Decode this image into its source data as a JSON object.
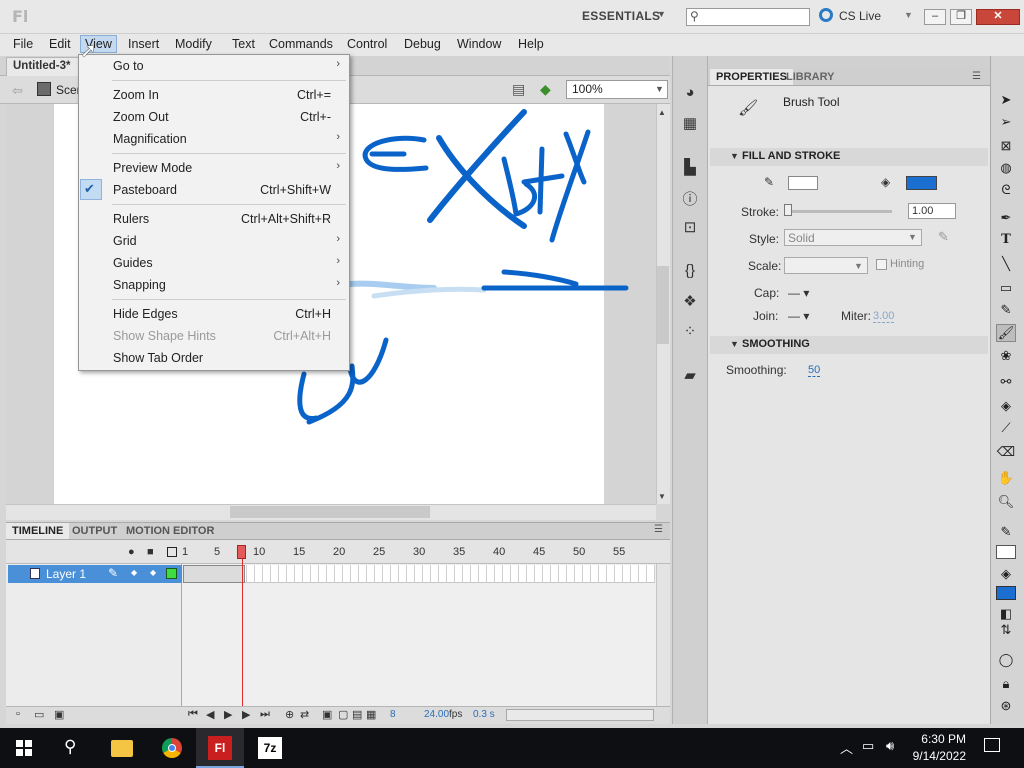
{
  "app": {
    "logo": "Fl",
    "workspace": "ESSENTIALS",
    "cs_live": "CS Live"
  },
  "menubar": [
    "File",
    "Edit",
    "View",
    "Insert",
    "Modify",
    "Text",
    "Commands",
    "Control",
    "Debug",
    "Window",
    "Help"
  ],
  "document": {
    "tab": "Untitled-3*",
    "scene": "Scene 1",
    "zoom": "100%"
  },
  "view_menu": [
    {
      "label": "Go to",
      "shortcut": "",
      "submenu": true
    },
    {
      "label": "Zoom In",
      "shortcut": "Ctrl+="
    },
    {
      "label": "Zoom Out",
      "shortcut": "Ctrl+-"
    },
    {
      "label": "Magnification",
      "shortcut": "",
      "submenu": true
    },
    {
      "label": "Preview Mode",
      "shortcut": "",
      "submenu": true
    },
    {
      "label": "Pasteboard",
      "shortcut": "Ctrl+Shift+W",
      "checked": true
    },
    {
      "label": "Rulers",
      "shortcut": "Ctrl+Alt+Shift+R"
    },
    {
      "label": "Grid",
      "shortcut": "",
      "submenu": true
    },
    {
      "label": "Guides",
      "shortcut": "",
      "submenu": true
    },
    {
      "label": "Snapping",
      "shortcut": "",
      "submenu": true
    },
    {
      "label": "Hide Edges",
      "shortcut": "Ctrl+H"
    },
    {
      "label": "Show Shape Hints",
      "shortcut": "Ctrl+Alt+H",
      "disabled": true
    },
    {
      "label": "Show Tab Order",
      "shortcut": ""
    }
  ],
  "timeline": {
    "tabs": [
      "TIMELINE",
      "OUTPUT",
      "MOTION EDITOR"
    ],
    "frame_numbers": [
      "1",
      "5",
      "10",
      "15",
      "20",
      "25",
      "30",
      "35",
      "40",
      "45",
      "50",
      "55"
    ],
    "layer_name": "Layer 1",
    "current_frame": "8",
    "fps": "24.00",
    "fps_unit": "fps",
    "elapsed": "0.3 s"
  },
  "properties": {
    "tabs": [
      "PROPERTIES",
      "LIBRARY"
    ],
    "tool": "Brush Tool",
    "fill_stroke_head": "FILL AND STROKE",
    "stroke_label": "Stroke:",
    "stroke_value": "1.00",
    "style_label": "Style:",
    "style_value": "Solid",
    "scale_label": "Scale:",
    "hinting_label": "Hinting",
    "cap_label": "Cap:",
    "join_label": "Join:",
    "miter_label": "Miter:",
    "miter_value": "3.00",
    "smoothing_head": "SMOOTHING",
    "smoothing_label": "Smoothing:",
    "smoothing_value": "50"
  },
  "colors": {
    "fill": "#1a6fd1",
    "stroke": "#ffffff",
    "brush": "#0a63c9",
    "accent": "#4a90d9"
  },
  "taskbar": {
    "time": "6:30 PM",
    "date": "9/14/2022",
    "flash_label": "Fl",
    "sevenzip_label": "7z"
  }
}
